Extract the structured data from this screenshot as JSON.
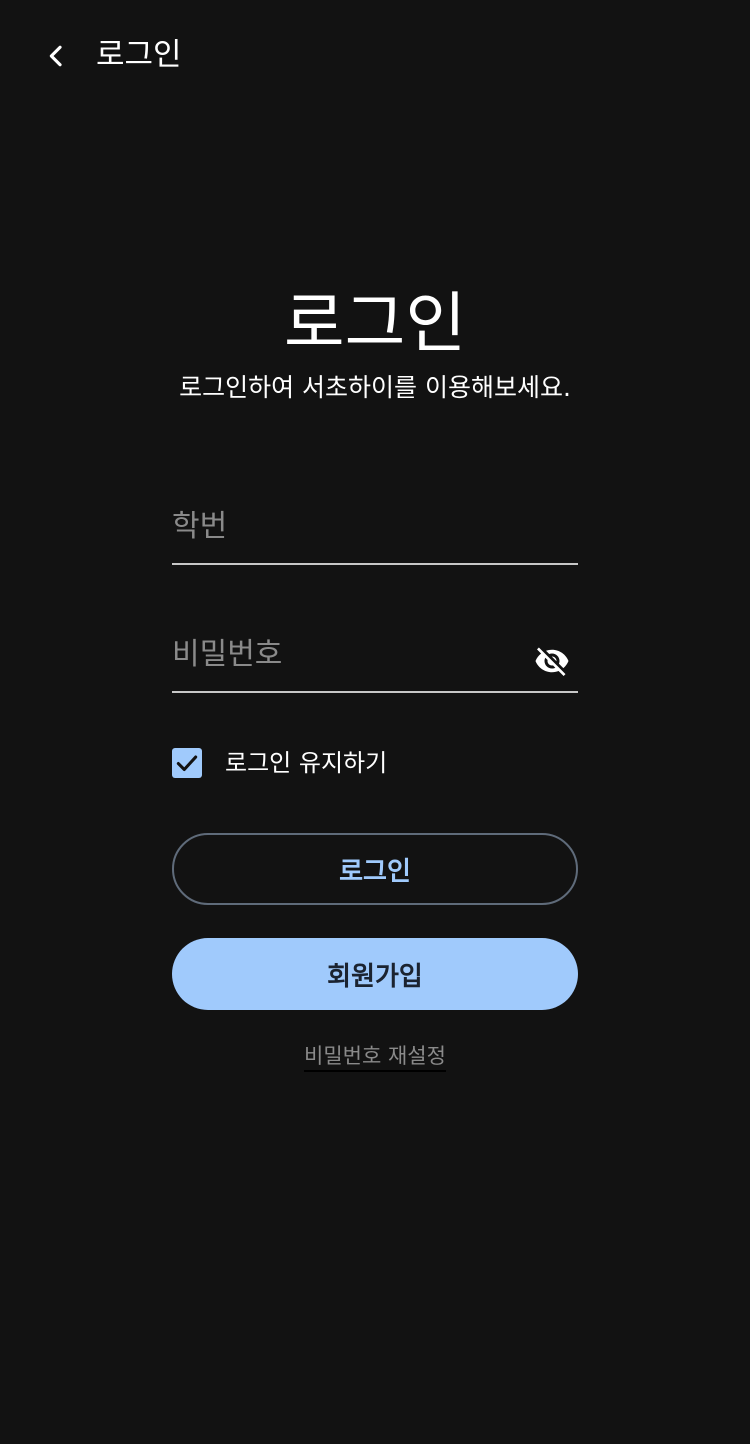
{
  "topbar": {
    "title": "로그인",
    "back_icon": "chevron-left-icon"
  },
  "headline": "로그인",
  "subtitle": "로그인하여 서초하이를 이용해보세요.",
  "form": {
    "student_id": {
      "placeholder": "학번",
      "value": ""
    },
    "password": {
      "placeholder": "비밀번호",
      "value": "",
      "visibility_icon": "eye-off-icon"
    },
    "remember": {
      "label": "로그인 유지하기",
      "checked": true
    }
  },
  "buttons": {
    "login_label": "로그인",
    "signup_label": "회원가입"
  },
  "reset_password_label": "비밀번호 재설정",
  "colors": {
    "background": "#121212",
    "accent": "#a0cafc",
    "outline": "#5f6b7a",
    "muted_text": "#8a8a8a"
  }
}
